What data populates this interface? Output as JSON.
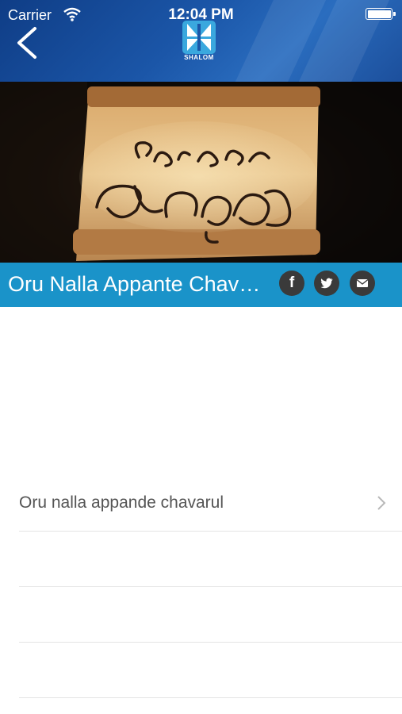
{
  "status_bar": {
    "carrier": "Carrier",
    "time": "12:04 PM"
  },
  "header": {
    "logo_text": "SHALOM"
  },
  "banner": {
    "image_icon": "show-title-scroll-artwork"
  },
  "title_bar": {
    "title": "Oru Nalla Appante Chavarul",
    "facebook_glyph": "f"
  },
  "list": {
    "items": [
      {
        "label": "Oru nalla appande chavarul"
      },
      {
        "label": ""
      },
      {
        "label": ""
      },
      {
        "label": ""
      }
    ]
  },
  "colors": {
    "header_blue": "#1b56a8",
    "title_bar_blue": "#1a93c9",
    "social_icon_bg": "#3a3a3a"
  }
}
